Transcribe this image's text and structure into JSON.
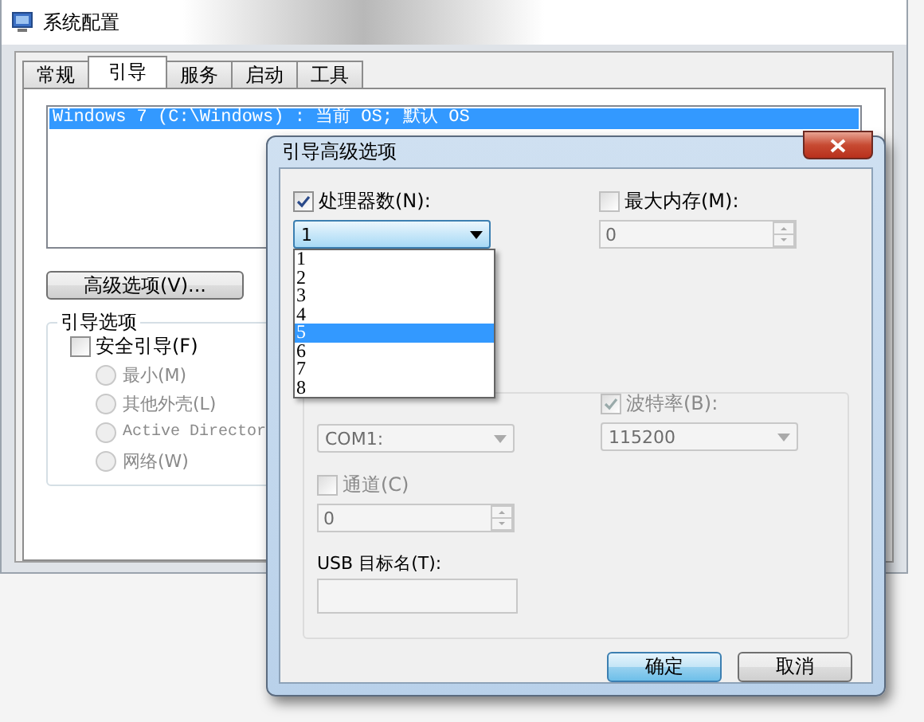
{
  "main_window": {
    "title": "系统配置",
    "tabs": [
      {
        "label": "常规",
        "selected": false
      },
      {
        "label": "引导",
        "selected": true
      },
      {
        "label": "服务",
        "selected": false
      },
      {
        "label": "启动",
        "selected": false
      },
      {
        "label": "工具",
        "selected": false
      }
    ],
    "boot_list": [
      {
        "label": "Windows 7 (C:\\Windows) : 当前 OS; 默认 OS",
        "selected": true
      }
    ],
    "advanced_button": "高级选项(V)...",
    "boot_options": {
      "title": "引导选项",
      "safe_boot": {
        "label": "安全引导(F)",
        "checked": false
      },
      "modes": [
        {
          "label": "最小(M)",
          "selected": false,
          "disabled": true
        },
        {
          "label": "其他外壳(L)",
          "selected": false,
          "disabled": true
        },
        {
          "label": "Active Director",
          "selected": false,
          "disabled": true
        },
        {
          "label": "网络(W)",
          "selected": false,
          "disabled": true
        }
      ]
    }
  },
  "dialog": {
    "title": "引导高级选项",
    "processors": {
      "label": "处理器数(N):",
      "checked": true,
      "value": "1",
      "options": [
        {
          "label": "1",
          "highlighted": false
        },
        {
          "label": "2",
          "highlighted": false
        },
        {
          "label": "3",
          "highlighted": false
        },
        {
          "label": "4",
          "highlighted": false
        },
        {
          "label": "5",
          "highlighted": true
        },
        {
          "label": "6",
          "highlighted": false
        },
        {
          "label": "7",
          "highlighted": false
        },
        {
          "label": "8",
          "highlighted": false
        }
      ]
    },
    "max_memory": {
      "label": "最大内存(M):",
      "checked": false,
      "value": "0",
      "disabled": true
    },
    "debug_port": {
      "value": "COM1:",
      "disabled": true
    },
    "baud_rate": {
      "label": "波特率(B):",
      "checked": true,
      "value": "115200",
      "disabled": true
    },
    "channel": {
      "label": "通道(C)",
      "checked": false,
      "value": "0",
      "disabled": true
    },
    "usb_target": {
      "label": "USB 目标名(T):",
      "disabled": true
    },
    "buttons": [
      {
        "label": "确定",
        "default": true
      },
      {
        "label": "取消",
        "default": false
      }
    ]
  }
}
